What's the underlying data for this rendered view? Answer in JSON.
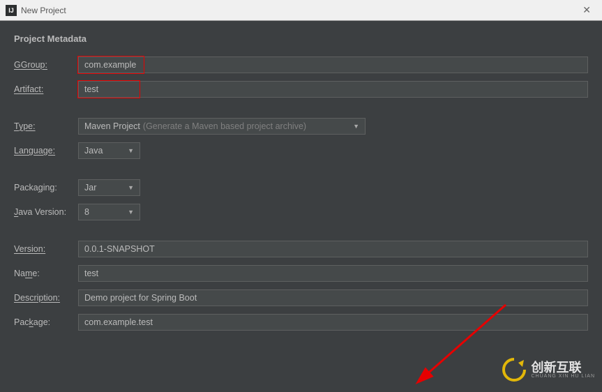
{
  "window": {
    "title": "New Project"
  },
  "section": {
    "title": "Project Metadata"
  },
  "labels": {
    "group": "Group:",
    "artifact": "Artifact:",
    "type": "Type:",
    "language": "Language:",
    "packaging": "Packaging:",
    "javaVersion": "Java Version:",
    "version": "Version:",
    "name": "Name:",
    "description": "Description:",
    "package": "Package:"
  },
  "values": {
    "group": "com.example",
    "artifact": "test",
    "type": "Maven Project",
    "typeHint": "(Generate a Maven based project archive)",
    "language": "Java",
    "packaging": "Jar",
    "javaVersion": "8",
    "version": "0.0.1-SNAPSHOT",
    "name": "test",
    "description": "Demo project for Spring Boot",
    "package": "com.example.test"
  },
  "watermark": {
    "main": "创新互联",
    "sub": "CHUANG XIN HU LIAN"
  }
}
